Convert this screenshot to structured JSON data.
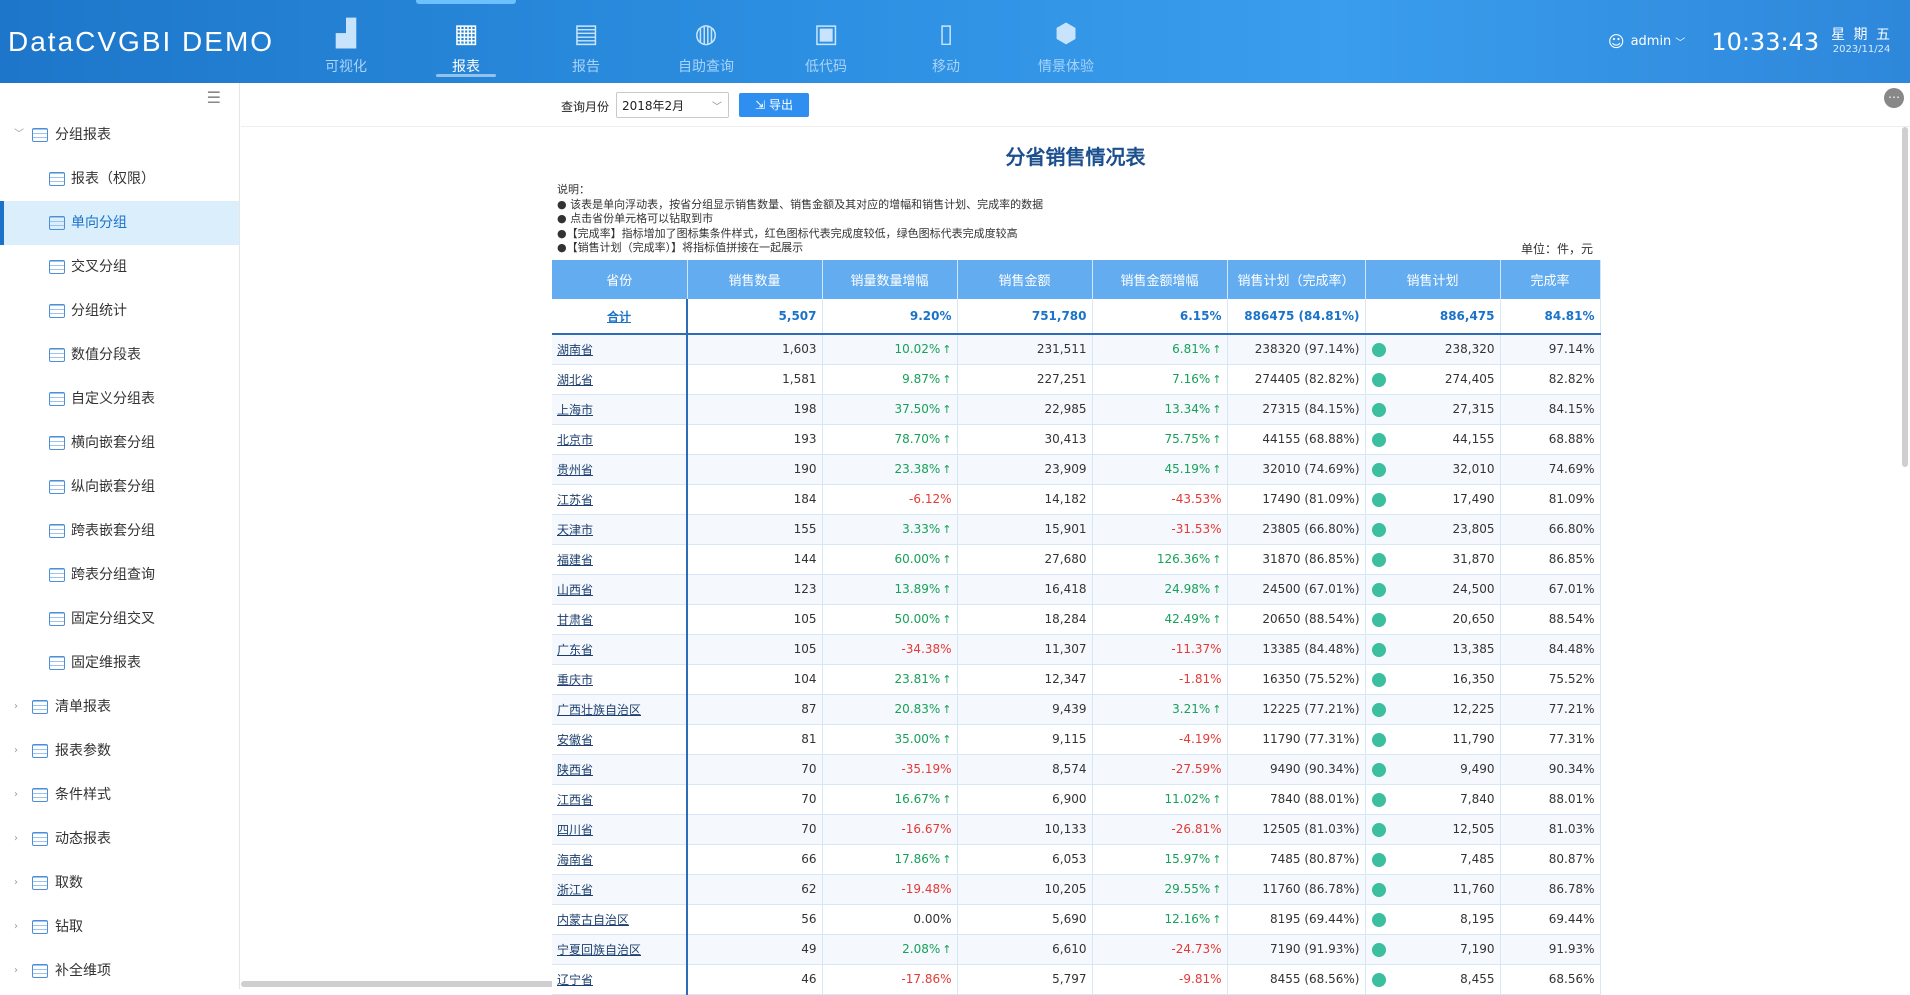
{
  "app_title": "DataCVGBI DEMO",
  "nav": [
    {
      "label": "可视化",
      "icon": "bar-chart-icon"
    },
    {
      "label": "报表",
      "icon": "table-icon",
      "active": true
    },
    {
      "label": "报告",
      "icon": "word-doc-icon"
    },
    {
      "label": "自助查询",
      "icon": "analysis-icon"
    },
    {
      "label": "低代码",
      "icon": "low-code-icon"
    },
    {
      "label": "移动",
      "icon": "mobile-icon"
    },
    {
      "label": "情景体验",
      "icon": "cube-icon"
    }
  ],
  "user": {
    "name": "admin"
  },
  "clock": {
    "time": "10:33:43",
    "weekday": "星 期 五",
    "date": "2023/11/24"
  },
  "sidebar": {
    "items": [
      {
        "label": "分组报表",
        "level": 0,
        "expanded": true
      },
      {
        "label": "报表（权限）",
        "level": 1
      },
      {
        "label": "单向分组",
        "level": 1,
        "active": true
      },
      {
        "label": "交叉分组",
        "level": 1
      },
      {
        "label": "分组统计",
        "level": 1
      },
      {
        "label": "数值分段表",
        "level": 1
      },
      {
        "label": "自定义分组表",
        "level": 1
      },
      {
        "label": "横向嵌套分组",
        "level": 1
      },
      {
        "label": "纵向嵌套分组",
        "level": 1
      },
      {
        "label": "跨表嵌套分组",
        "level": 1
      },
      {
        "label": "跨表分组查询",
        "level": 1
      },
      {
        "label": "固定分组交叉",
        "level": 1
      },
      {
        "label": "固定维报表",
        "level": 1
      },
      {
        "label": "清单报表",
        "level": 0
      },
      {
        "label": "报表参数",
        "level": 0
      },
      {
        "label": "条件样式",
        "level": 0
      },
      {
        "label": "动态报表",
        "level": 0
      },
      {
        "label": "取数",
        "level": 0
      },
      {
        "label": "钻取",
        "level": 0
      },
      {
        "label": "补全维项",
        "level": 0
      }
    ]
  },
  "toolbar": {
    "query_label": "查询月份",
    "query_value": "2018年2月",
    "export_label": "导出"
  },
  "report": {
    "title": "分省销售情况表",
    "notes": [
      "说明：",
      "●  该表是单向浮动表，按省分组显示销售数量、销售金额及其对应的增幅和销售计划、完成率的数据",
      "●  点击省份单元格可以钻取到市",
      "●【完成率】指标增加了图标集条件样式，红色图标代表完成度较低，绿色图标代表完成度较高",
      "●【销售计划（完成率）】将指标值拼接在一起展示"
    ],
    "unit": "单位：件，元",
    "columns": [
      "省份",
      "销售数量",
      "销量数量增幅",
      "销售金额",
      "销售金额增幅",
      "销售计划（完成率）",
      "销售计划",
      "完成率"
    ],
    "total": {
      "province": "合计",
      "qty": "5,507",
      "qty_growth": "9.20%",
      "amount": "751,780",
      "amount_growth": "6.15%",
      "plan_rate": "886475  (84.81%)",
      "plan": "886,475",
      "rate": "84.81%"
    },
    "rows": [
      {
        "province": "湖南省",
        "qty": "1,603",
        "qty_growth": "10.02%",
        "amount": "231,511",
        "amount_growth": "6.81%",
        "plan_rate": "238320  (97.14%)",
        "plan": "238,320",
        "rate": "97.14%"
      },
      {
        "province": "湖北省",
        "qty": "1,581",
        "qty_growth": "9.87%",
        "amount": "227,251",
        "amount_growth": "7.16%",
        "plan_rate": "274405  (82.82%)",
        "plan": "274,405",
        "rate": "82.82%"
      },
      {
        "province": "上海市",
        "qty": "198",
        "qty_growth": "37.50%",
        "amount": "22,985",
        "amount_growth": "13.34%",
        "plan_rate": "27315  (84.15%)",
        "plan": "27,315",
        "rate": "84.15%"
      },
      {
        "province": "北京市",
        "qty": "193",
        "qty_growth": "78.70%",
        "amount": "30,413",
        "amount_growth": "75.75%",
        "plan_rate": "44155  (68.88%)",
        "plan": "44,155",
        "rate": "68.88%"
      },
      {
        "province": "贵州省",
        "qty": "190",
        "qty_growth": "23.38%",
        "amount": "23,909",
        "amount_growth": "45.19%",
        "plan_rate": "32010  (74.69%)",
        "plan": "32,010",
        "rate": "74.69%"
      },
      {
        "province": "江苏省",
        "qty": "184",
        "qty_growth": "-6.12%",
        "amount": "14,182",
        "amount_growth": "-43.53%",
        "plan_rate": "17490  (81.09%)",
        "plan": "17,490",
        "rate": "81.09%"
      },
      {
        "province": "天津市",
        "qty": "155",
        "qty_growth": "3.33%",
        "amount": "15,901",
        "amount_growth": "-31.53%",
        "plan_rate": "23805  (66.80%)",
        "plan": "23,805",
        "rate": "66.80%"
      },
      {
        "province": "福建省",
        "qty": "144",
        "qty_growth": "60.00%",
        "amount": "27,680",
        "amount_growth": "126.36%",
        "plan_rate": "31870  (86.85%)",
        "plan": "31,870",
        "rate": "86.85%"
      },
      {
        "province": "山西省",
        "qty": "123",
        "qty_growth": "13.89%",
        "amount": "16,418",
        "amount_growth": "24.98%",
        "plan_rate": "24500  (67.01%)",
        "plan": "24,500",
        "rate": "67.01%"
      },
      {
        "province": "甘肃省",
        "qty": "105",
        "qty_growth": "50.00%",
        "amount": "18,284",
        "amount_growth": "42.49%",
        "plan_rate": "20650  (88.54%)",
        "plan": "20,650",
        "rate": "88.54%"
      },
      {
        "province": "广东省",
        "qty": "105",
        "qty_growth": "-34.38%",
        "amount": "11,307",
        "amount_growth": "-11.37%",
        "plan_rate": "13385  (84.48%)",
        "plan": "13,385",
        "rate": "84.48%"
      },
      {
        "province": "重庆市",
        "qty": "104",
        "qty_growth": "23.81%",
        "amount": "12,347",
        "amount_growth": "-1.81%",
        "plan_rate": "16350  (75.52%)",
        "plan": "16,350",
        "rate": "75.52%"
      },
      {
        "province": "广西壮族自治区",
        "qty": "87",
        "qty_growth": "20.83%",
        "amount": "9,439",
        "amount_growth": "3.21%",
        "plan_rate": "12225  (77.21%)",
        "plan": "12,225",
        "rate": "77.21%"
      },
      {
        "province": "安徽省",
        "qty": "81",
        "qty_growth": "35.00%",
        "amount": "9,115",
        "amount_growth": "-4.19%",
        "plan_rate": "11790  (77.31%)",
        "plan": "11,790",
        "rate": "77.31%"
      },
      {
        "province": "陕西省",
        "qty": "70",
        "qty_growth": "-35.19%",
        "amount": "8,574",
        "amount_growth": "-27.59%",
        "plan_rate": "9490  (90.34%)",
        "plan": "9,490",
        "rate": "90.34%"
      },
      {
        "province": "江西省",
        "qty": "70",
        "qty_growth": "16.67%",
        "amount": "6,900",
        "amount_growth": "11.02%",
        "plan_rate": "7840  (88.01%)",
        "plan": "7,840",
        "rate": "88.01%"
      },
      {
        "province": "四川省",
        "qty": "70",
        "qty_growth": "-16.67%",
        "amount": "10,133",
        "amount_growth": "-26.81%",
        "plan_rate": "12505  (81.03%)",
        "plan": "12,505",
        "rate": "81.03%"
      },
      {
        "province": "海南省",
        "qty": "66",
        "qty_growth": "17.86%",
        "amount": "6,053",
        "amount_growth": "15.97%",
        "plan_rate": "7485  (80.87%)",
        "plan": "7,485",
        "rate": "80.87%"
      },
      {
        "province": "浙江省",
        "qty": "62",
        "qty_growth": "-19.48%",
        "amount": "10,205",
        "amount_growth": "29.55%",
        "plan_rate": "11760  (86.78%)",
        "plan": "11,760",
        "rate": "86.78%"
      },
      {
        "province": "内蒙古自治区",
        "qty": "56",
        "qty_growth": "0.00%",
        "amount": "5,690",
        "amount_growth": "12.16%",
        "plan_rate": "8195  (69.44%)",
        "plan": "8,195",
        "rate": "69.44%"
      },
      {
        "province": "宁夏回族自治区",
        "qty": "49",
        "qty_growth": "2.08%",
        "amount": "6,610",
        "amount_growth": "-24.73%",
        "plan_rate": "7190  (91.93%)",
        "plan": "7,190",
        "rate": "91.93%"
      },
      {
        "province": "辽宁省",
        "qty": "46",
        "qty_growth": "-17.86%",
        "amount": "5,797",
        "amount_growth": "-9.81%",
        "plan_rate": "8455  (68.56%)",
        "plan": "8,455",
        "rate": "68.56%"
      }
    ]
  },
  "colors": {
    "header_blue": "#2c8ee0",
    "positive": "#18a058",
    "negative": "#e53935",
    "dot": "#3bbf9f",
    "title": "#1b4f8e"
  }
}
